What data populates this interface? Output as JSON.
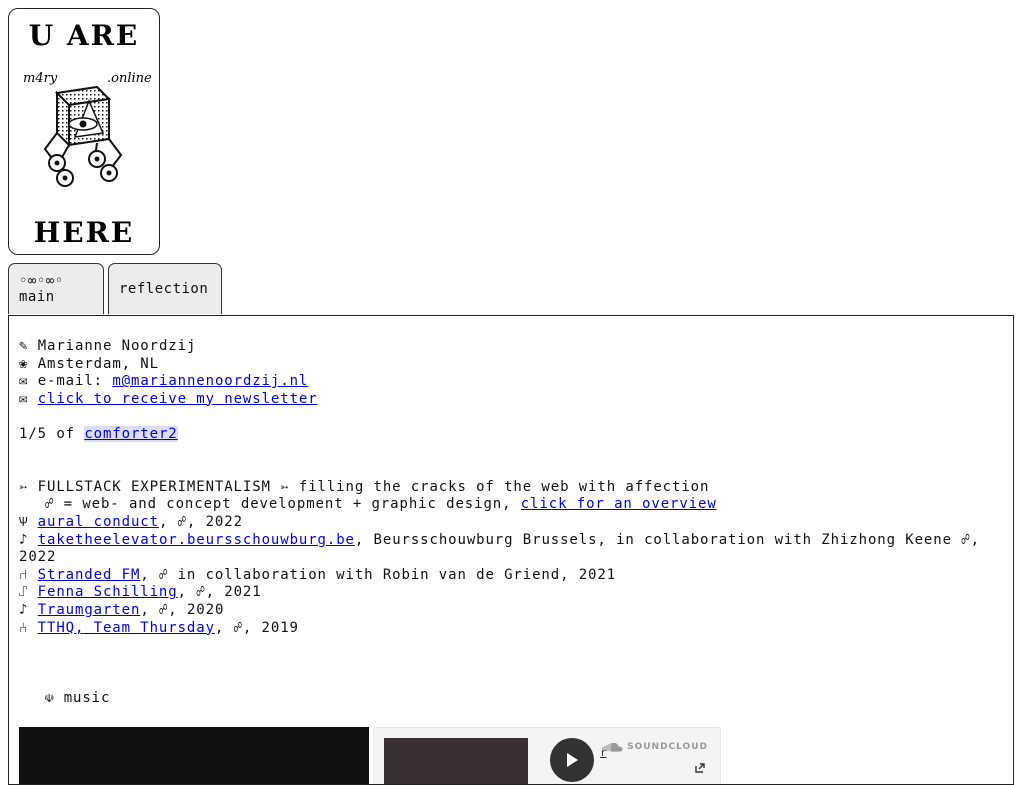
{
  "logo": {
    "top_text": "U ARE",
    "bottom_text": "HERE",
    "left_label": "m4ry",
    "right_label": ".online"
  },
  "tabs": [
    {
      "label": "◦∞◦∞◦ main",
      "active": true
    },
    {
      "label": "reflection",
      "active": false
    }
  ],
  "contact": {
    "name_icon": "✎",
    "name": "Marianne Noordzij",
    "location_icon": "❀",
    "location": "Amsterdam, NL",
    "email_icon": "✉",
    "email_label": "e-mail:",
    "email": "m@mariannenoordzij.nl",
    "newsletter_icon": "✉",
    "newsletter_link": "click to receive my newsletter"
  },
  "slideshow": {
    "counter": "1/5 of",
    "link": "comforter2"
  },
  "intro": {
    "headline": "➳ FULLSTACK EXPERIMENTALISM ➳ filling the cracks of the web with affection",
    "legend_prefix": "☍ = web- and concept development + graphic design,",
    "legend_link": "click for an overview"
  },
  "projects": [
    {
      "icon": "Ѱ",
      "title": "aural conduct",
      "rest": ", ☍, 2022"
    },
    {
      "icon": "♪",
      "title": "taketheelevator.beursschouwburg.be",
      "rest": ", Beursschouwburg Brussels, in collaboration with Zhizhong Keene ☍, 2022"
    },
    {
      "icon": "⑁",
      "title": "Stranded FM",
      "rest": ", ☍ in collaboration with Robin van de Griend, 2021"
    },
    {
      "icon": "⑀",
      "title": "Fenna Schilling",
      "rest": ", ☍, 2021"
    },
    {
      "icon": "♪",
      "title": "Traumgarten",
      "rest": ", ☍, 2020"
    },
    {
      "icon": "⑃",
      "title": "TTHQ, Team Thursday",
      "rest": ", ☍, 2019"
    }
  ],
  "music": {
    "icon": "☫",
    "label": "music"
  },
  "soundcloud": {
    "brand": "SOUNDCLOUD",
    "link_char": "r"
  }
}
